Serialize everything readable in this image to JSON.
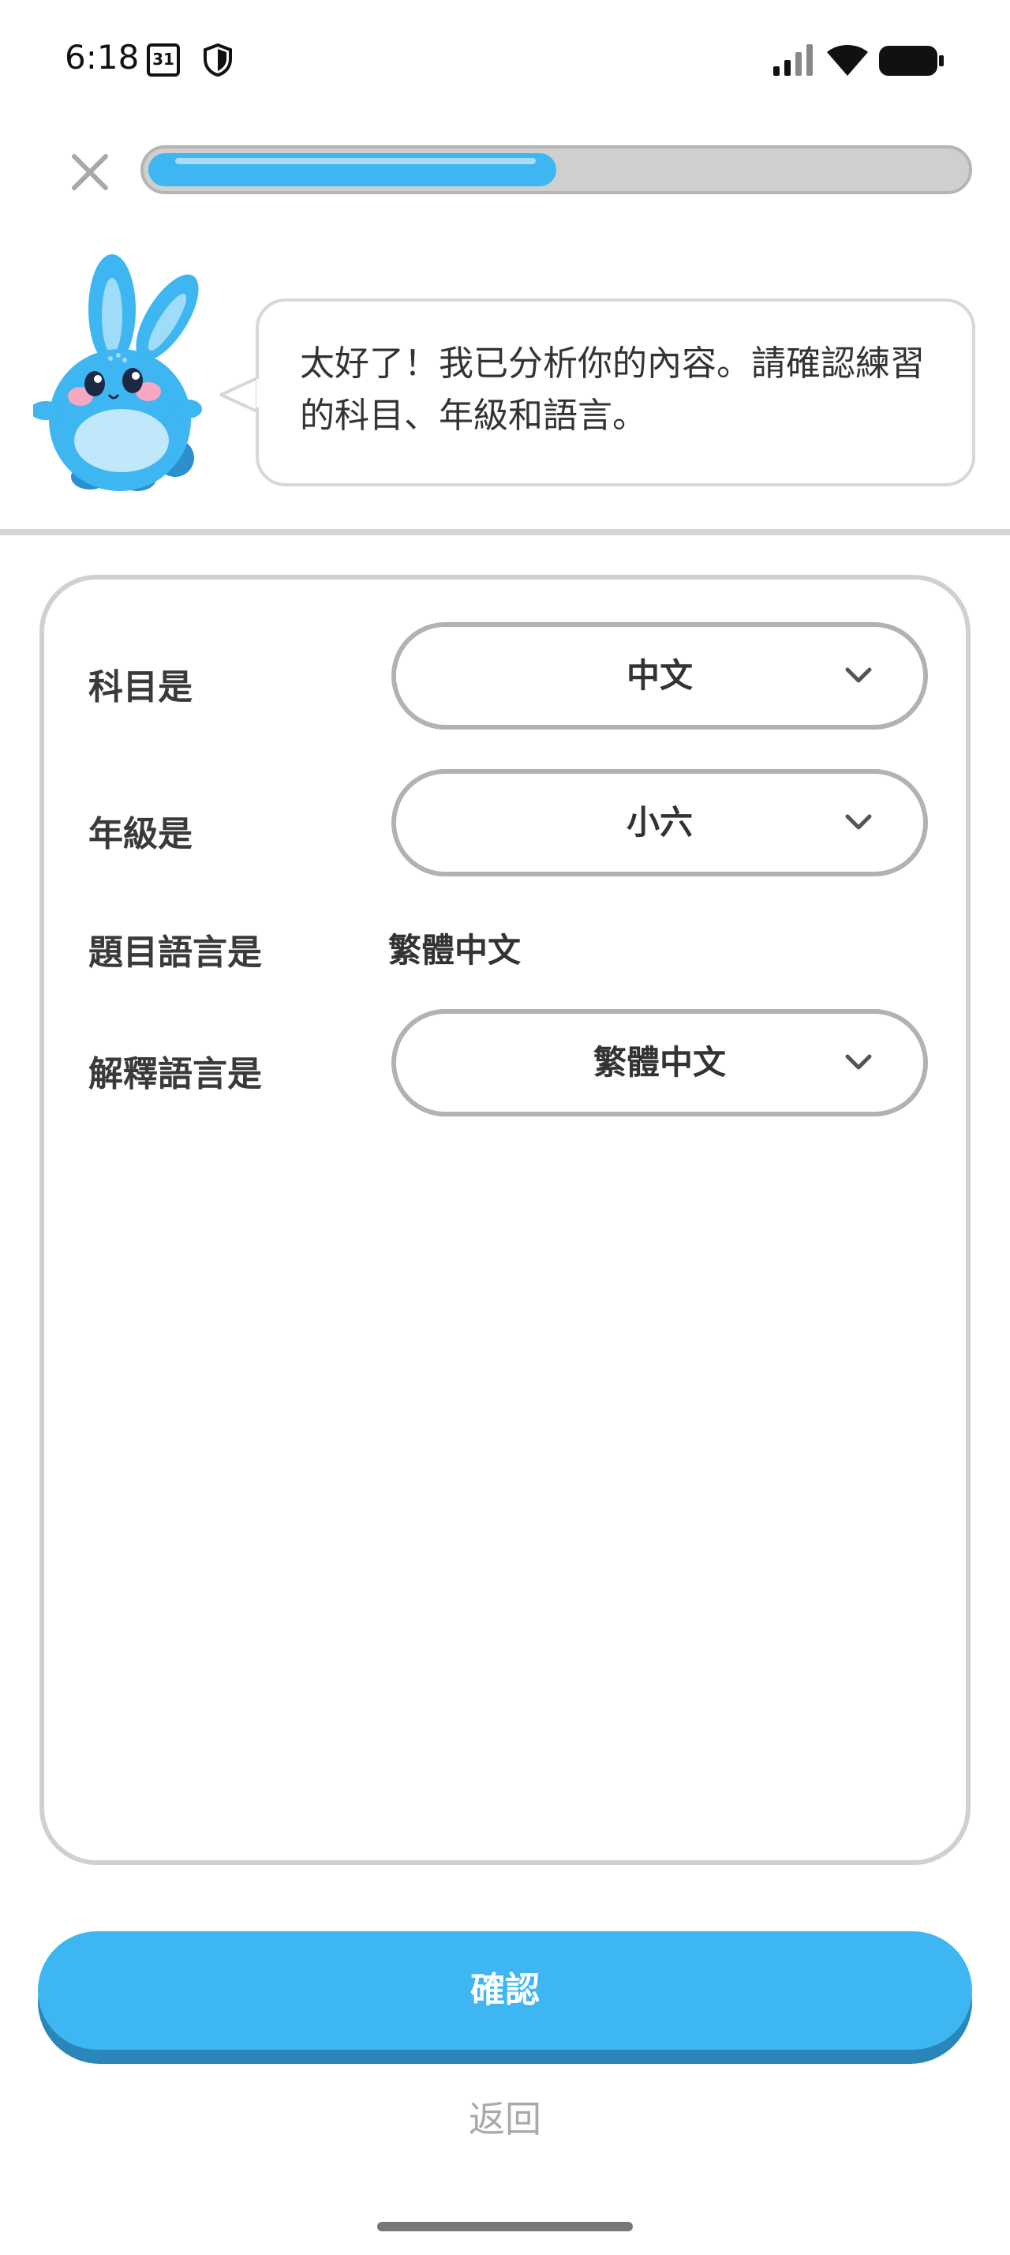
{
  "status_bar": {
    "time": "6:18",
    "calendar_day": "31",
    "icons": [
      "calendar-icon",
      "shield-icon",
      "signal-icon",
      "wifi-icon",
      "battery-icon"
    ]
  },
  "header": {
    "close_icon": "close-icon",
    "progress_percent": 50
  },
  "mascot": {
    "message": "太好了！我已分析你的內容。請確認練習的科目、年級和語言。"
  },
  "form": {
    "subject": {
      "label": "科目是",
      "value": "中文"
    },
    "grade": {
      "label": "年級是",
      "value": "小六"
    },
    "question_language": {
      "label": "題目語言是",
      "value": "繁體中文"
    },
    "explanation_language": {
      "label": "解釋語言是",
      "value": "繁體中文"
    }
  },
  "actions": {
    "confirm_label": "確認",
    "back_label": "返回"
  },
  "colors": {
    "accent": "#3db6f2",
    "accent_shadow": "#2a86b8",
    "border": "#d0d0d0",
    "muted_text": "#a9a9a9"
  }
}
